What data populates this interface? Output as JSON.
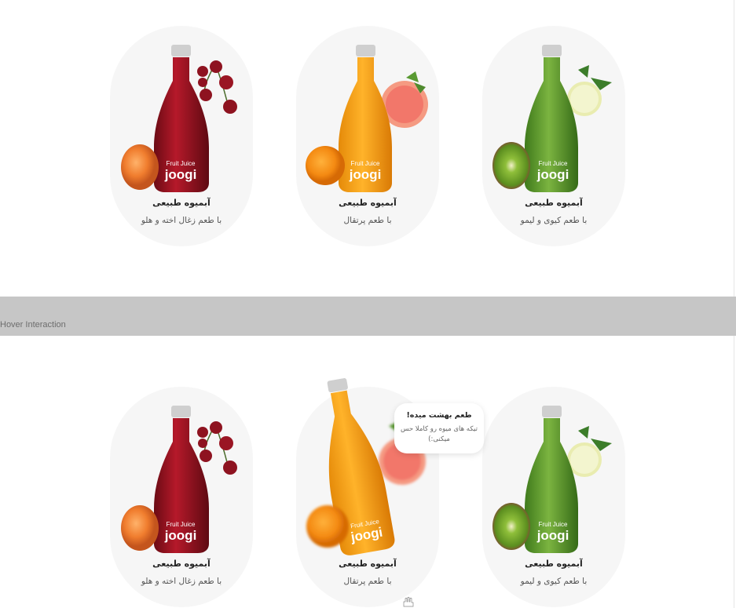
{
  "divider": {
    "label": "Hover Interaction"
  },
  "cards": [
    {
      "title": "آبمیوه طبیعی",
      "subtitle": "با طعم کیوی و لیمو",
      "bottle_color": "#5e9a2e",
      "fruit": "kiwi-lemon"
    },
    {
      "title": "آبمیوه طبیعی",
      "subtitle": "با طعم پرتقال",
      "bottle_color": "#f2a21a",
      "fruit": "orange-grapefruit"
    },
    {
      "title": "آبمیوه طبیعی",
      "subtitle": "با طعم زغال اخته و هلو",
      "bottle_color": "#a31522",
      "fruit": "cherry-peach"
    }
  ],
  "hover_cards": [
    {
      "title": "آبمیوه طبیعی",
      "subtitle": "با طعم کیوی و لیمو"
    },
    {
      "title": "آبمیوه طبیعی",
      "subtitle": "با طعم پرتقال"
    },
    {
      "title": "آبمیوه طبیعی",
      "subtitle": "با طعم زغال اخته و هلو"
    }
  ],
  "brand": {
    "name": "joogi",
    "tagline": "Fruit Juice"
  },
  "tooltip": {
    "title": "طعم بهشت میده!",
    "text": "تیکه های میوه رو کاملا حس میکنی:)"
  },
  "colors": {
    "card_bg": "#f6f6f6",
    "divider_bg": "#c6c6c6",
    "kiwi_bottle": "#5e9a2e",
    "orange_bottle": "#f2a21a",
    "cherry_bottle": "#a31522"
  },
  "icons": {
    "cursor": "hand-pointer-icon"
  }
}
